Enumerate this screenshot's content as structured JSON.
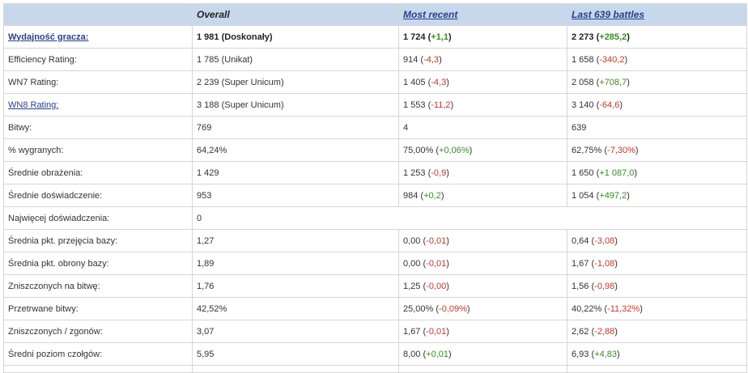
{
  "headers": [
    "",
    "Overall",
    "Most recent",
    "Last 639 battles"
  ],
  "rows": [
    {
      "label": "Wydajność gracza:",
      "link": true,
      "bold": true,
      "cells": [
        {
          "v": "1 981 (Doskonały)"
        },
        {
          "v": "1 724",
          "d": "+1,1",
          "s": "pos"
        },
        {
          "v": "2 273",
          "d": "+285,2",
          "s": "pos"
        }
      ]
    },
    {
      "label": "Efficiency Rating:",
      "cells": [
        {
          "v": "1 785 (Unikat)"
        },
        {
          "v": "914",
          "d": "-4,3",
          "s": "neg"
        },
        {
          "v": "1 658",
          "d": "-340,2",
          "s": "neg"
        }
      ]
    },
    {
      "label": "WN7 Rating:",
      "cells": [
        {
          "v": "2 239 (Super Unicum)"
        },
        {
          "v": "1 405",
          "d": "-4,3",
          "s": "neg"
        },
        {
          "v": "2 058",
          "d": "+708,7",
          "s": "pos"
        }
      ]
    },
    {
      "label": "WN8 Rating:",
      "link": true,
      "cells": [
        {
          "v": "3 188 (Super Unicum)"
        },
        {
          "v": "1 553",
          "d": "-11,2",
          "s": "neg"
        },
        {
          "v": "3 140",
          "d": "-64,6",
          "s": "neg"
        }
      ]
    },
    {
      "label": "Bitwy:",
      "cells": [
        {
          "v": "769"
        },
        {
          "v": "4"
        },
        {
          "v": "639"
        }
      ]
    },
    {
      "label": "% wygranych:",
      "cells": [
        {
          "v": "64,24%"
        },
        {
          "v": "75,00%",
          "d": "+0,06%",
          "s": "pos"
        },
        {
          "v": "62,75%",
          "d": "-7,30%",
          "s": "neg"
        }
      ]
    },
    {
      "label": "Średnie obrażenia:",
      "cells": [
        {
          "v": "1 429"
        },
        {
          "v": "1 253",
          "d": "-0,9",
          "s": "neg"
        },
        {
          "v": "1 650",
          "d": "+1 087,0",
          "s": "pos"
        }
      ]
    },
    {
      "label": "Średnie doświadczenie:",
      "cells": [
        {
          "v": "953"
        },
        {
          "v": "984",
          "d": "+0,2",
          "s": "pos"
        },
        {
          "v": "1 054",
          "d": "+497,2",
          "s": "pos"
        }
      ]
    },
    {
      "label": "Najwięcej doświadczenia:",
      "merged": true,
      "cells": [
        {
          "v": "0"
        }
      ]
    },
    {
      "label": "Średnia pkt. przejęcia bazy:",
      "cells": [
        {
          "v": "1,27"
        },
        {
          "v": "0,00",
          "d": "-0,01",
          "s": "neg"
        },
        {
          "v": "0,64",
          "d": "-3,08",
          "s": "neg"
        }
      ]
    },
    {
      "label": "Średnia pkt. obrony bazy:",
      "cells": [
        {
          "v": "1,89"
        },
        {
          "v": "0,00",
          "d": "-0,01",
          "s": "neg"
        },
        {
          "v": "1,67",
          "d": "-1,08",
          "s": "neg"
        }
      ]
    },
    {
      "label": "Zniszczonych na bitwę:",
      "cells": [
        {
          "v": "1,76"
        },
        {
          "v": "1,25",
          "d": "-0,00",
          "s": "neg"
        },
        {
          "v": "1,56",
          "d": "-0,98",
          "s": "neg"
        }
      ]
    },
    {
      "label": "Przetrwane bitwy:",
      "cells": [
        {
          "v": "42,52%"
        },
        {
          "v": "25,00%",
          "d": "-0,09%",
          "s": "neg"
        },
        {
          "v": "40,22%",
          "d": "-11,32%",
          "s": "neg"
        }
      ]
    },
    {
      "label": "Zniszczonych / zgonów:",
      "cells": [
        {
          "v": "3,07"
        },
        {
          "v": "1,67",
          "d": "-0,01",
          "s": "neg"
        },
        {
          "v": "2,62",
          "d": "-2,88",
          "s": "neg"
        }
      ]
    },
    {
      "label": "Średni poziom czołgów:",
      "cells": [
        {
          "v": "5,95"
        },
        {
          "v": "8,00",
          "d": "+0,01",
          "s": "pos"
        },
        {
          "v": "6,93",
          "d": "+4,83",
          "s": "pos"
        }
      ]
    }
  ],
  "colors": {
    "header_bg": "#c8d8ec",
    "link": "#2a3f86",
    "positive": "#3a8a2a",
    "negative": "#c0392b"
  }
}
